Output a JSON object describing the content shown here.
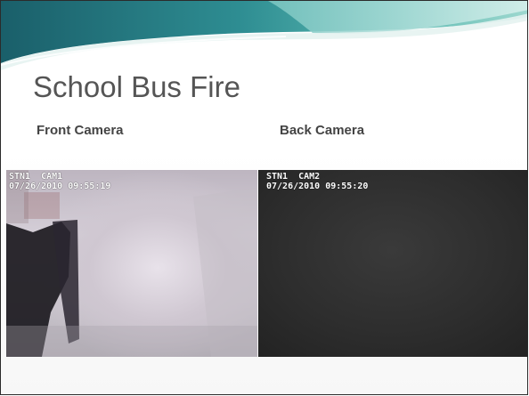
{
  "slide": {
    "title": "School Bus Fire",
    "front_label": "Front Camera",
    "back_label": "Back Camera"
  },
  "front_feed": {
    "station_line": "STN1  CAM1",
    "timestamp_line": "07/26/2010 09:55:19"
  },
  "back_feed": {
    "station_line": "STN1  CAM2",
    "timestamp_line": "07/26/2010 09:55:20"
  },
  "colors": {
    "banner_dark": "#1f6f73",
    "banner_mid": "#3aa6a4",
    "banner_light": "#bfe6e2",
    "title_text": "#555555"
  }
}
